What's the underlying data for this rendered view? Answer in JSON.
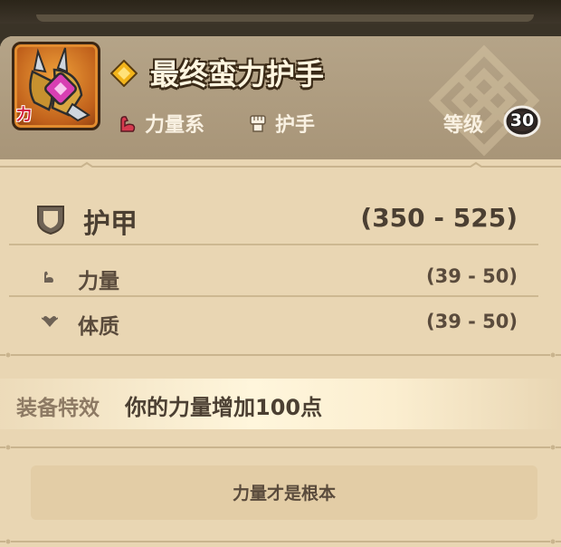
{
  "item": {
    "name": "最终蛮力护手",
    "icon": "gauntlet-icon",
    "icon_badge": "力",
    "rarity_icon": "gold-diamond-icon",
    "type_tag": "力量系",
    "type_icon": "strength-arm-icon",
    "slot_tag": "护手",
    "slot_icon": "fist-icon",
    "level_label": "等级",
    "level": "30"
  },
  "main_stat": {
    "name": "护甲",
    "icon": "shield-icon",
    "range": "(350 - 525)"
  },
  "sub_stats": [
    {
      "name": "力量",
      "icon": "arm-icon",
      "range": "(39 - 50)"
    },
    {
      "name": "体质",
      "icon": "heart-icon",
      "range": "(39 - 50)"
    }
  ],
  "effect": {
    "label": "装备特效",
    "text": "你的力量增加100点"
  },
  "flavor_text": "力量才是根本",
  "colors": {
    "header_bg": "#ab987b",
    "panel_bg": "#e9d6b3",
    "type_tag_icon": "#d63a4f",
    "rarity": "#f2b41b"
  }
}
